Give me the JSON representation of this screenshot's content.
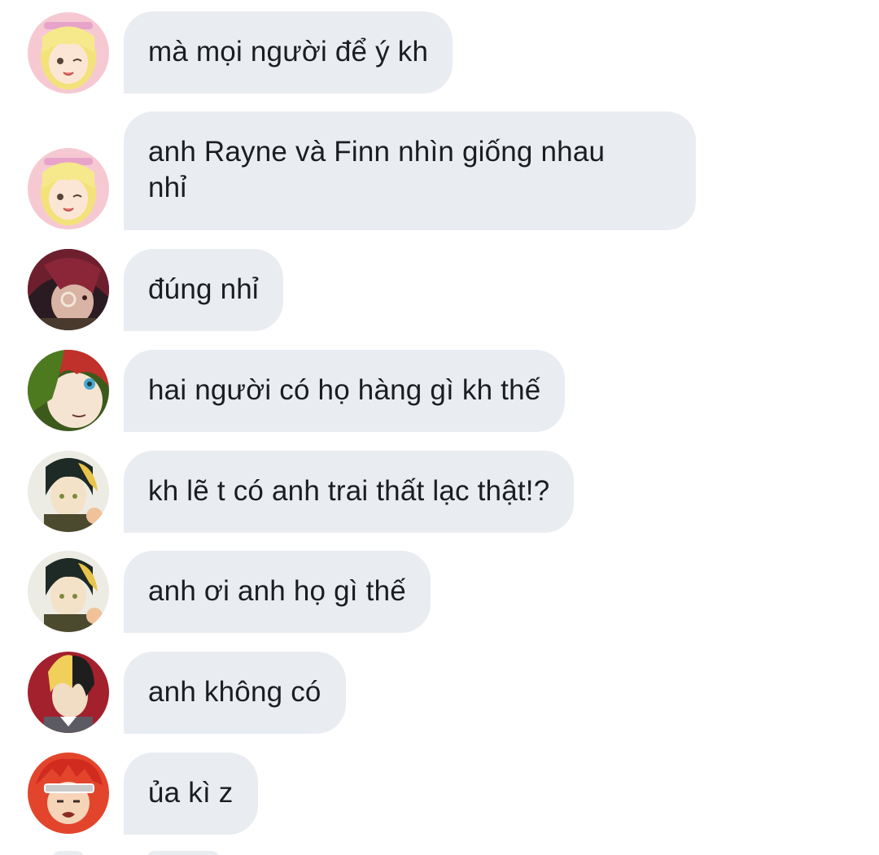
{
  "messages": [
    {
      "avatar": "avatar-blonde-girl",
      "text": "mà mọi người để ý kh"
    },
    {
      "avatar": "avatar-blonde-girl",
      "text": "anh Rayne và Finn nhìn giống nhau\nnhỉ"
    },
    {
      "avatar": "avatar-dark-red-hair",
      "text": "đúng nhỉ"
    },
    {
      "avatar": "avatar-red-green-hair",
      "text": "hai người có họ hàng gì kh thế"
    },
    {
      "avatar": "avatar-black-blond-hair",
      "text": "kh lẽ t có anh trai thất lạc thật!?"
    },
    {
      "avatar": "avatar-black-blond-hair",
      "text": "anh ơi anh họ gì thế"
    },
    {
      "avatar": "avatar-split-hair-red-bg",
      "text": "anh không có"
    },
    {
      "avatar": "avatar-red-hair-headband",
      "text": "ủa kì z"
    }
  ],
  "colors": {
    "bubble": "#e9edf1",
    "text": "#1b1d20",
    "background": "#ffffff"
  }
}
